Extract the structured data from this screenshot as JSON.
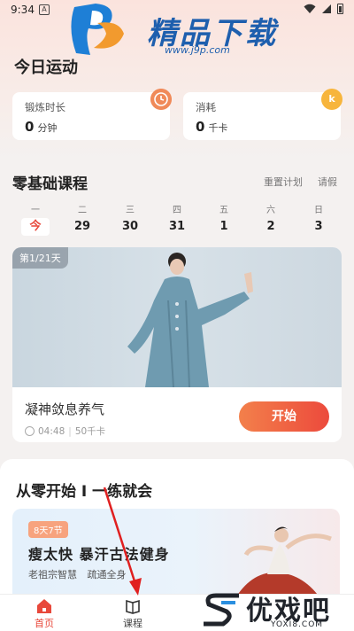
{
  "status_bar": {
    "time": "9:34"
  },
  "watermark_top": {
    "title": "精品下载",
    "url": "www.j9p.com"
  },
  "header": {
    "title": "今日运动"
  },
  "stats": [
    {
      "label": "锻炼时长",
      "value": "0",
      "unit": "分钟",
      "icon": "clock-icon"
    },
    {
      "label": "消耗",
      "value": "0",
      "unit": "千卡",
      "icon": "k-icon",
      "badge_text": "k"
    }
  ],
  "plan": {
    "title": "零基础课程",
    "reset_label": "重置计划",
    "leave_label": "请假",
    "week": [
      {
        "name": "一",
        "date": "今",
        "today": true
      },
      {
        "name": "二",
        "date": "29"
      },
      {
        "name": "三",
        "date": "30"
      },
      {
        "name": "四",
        "date": "31"
      },
      {
        "name": "五",
        "date": "1"
      },
      {
        "name": "六",
        "date": "2"
      },
      {
        "name": "日",
        "date": "3"
      }
    ]
  },
  "course": {
    "day_badge": "第1/21天",
    "name": "凝神敛息养气",
    "duration": "04:48",
    "calories": "50千卡",
    "start_label": "开始"
  },
  "series": {
    "title": "从零开始 I 一练就会",
    "promo": {
      "tag": "8天7节",
      "title": "瘦太快 暴汗古法健身",
      "sub": [
        "老祖宗智慧",
        "疏通全身"
      ]
    }
  },
  "nav": [
    {
      "label": "首页",
      "icon": "home-icon",
      "active": true
    },
    {
      "label": "课程",
      "icon": "book-icon",
      "active": false
    }
  ],
  "watermark_bottom": {
    "title": "优戏吧",
    "url": "YOXI8.COM"
  },
  "colors": {
    "accent": "#e8483b",
    "start_gradient": [
      "#f3804b",
      "#ec4a3c"
    ],
    "watermark_blue": "#1e5fae"
  }
}
